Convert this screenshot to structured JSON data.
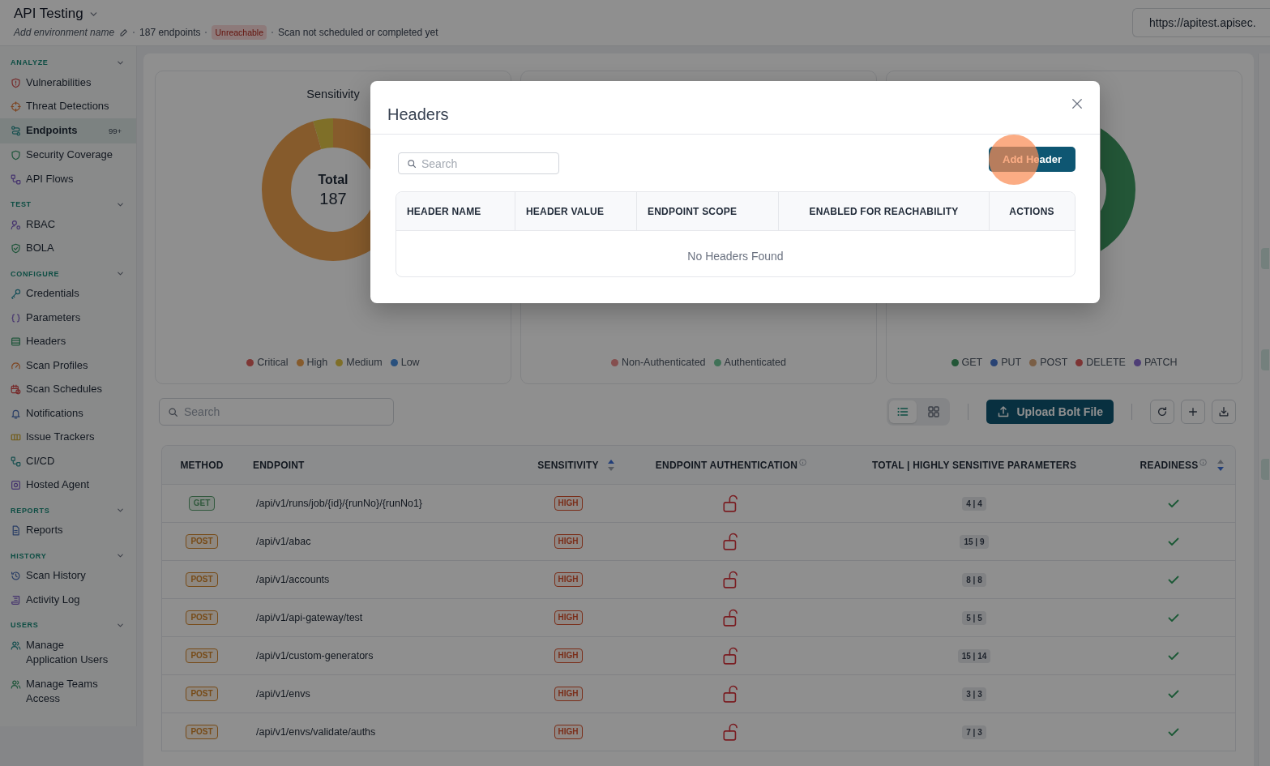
{
  "top_bar": {
    "title": "API Testing",
    "environment_name": "Add environment name",
    "endpoint_count": "187 endpoints",
    "status_badge": "Unreachable",
    "scan_status": "Scan not scheduled or completed yet",
    "url": "https://apitest.apisec."
  },
  "sidebar": {
    "sections": [
      {
        "title": "ANALYZE",
        "expanded": true,
        "items": [
          {
            "label": "Vulnerabilities",
            "selected": false
          },
          {
            "label": "Threat Detections",
            "selected": false
          },
          {
            "label": "Endpoints",
            "selected": true,
            "badge": "99+"
          },
          {
            "label": "Security Coverage",
            "selected": false
          },
          {
            "label": "API Flows",
            "selected": false
          }
        ]
      },
      {
        "title": "TEST",
        "expanded": true,
        "items": [
          {
            "label": "RBAC",
            "selected": false
          },
          {
            "label": "BOLA",
            "selected": false
          }
        ]
      },
      {
        "title": "CONFIGURE",
        "expanded": true,
        "items": [
          {
            "label": "Credentials",
            "selected": false
          },
          {
            "label": "Parameters",
            "selected": false
          },
          {
            "label": "Headers",
            "selected": false
          },
          {
            "label": "Scan Profiles",
            "selected": false
          },
          {
            "label": "Scan Schedules",
            "selected": false
          },
          {
            "label": "Notifications",
            "selected": false
          },
          {
            "label": "Issue Trackers",
            "selected": false
          },
          {
            "label": "CI/CD",
            "selected": false
          },
          {
            "label": "Hosted Agent",
            "selected": false
          }
        ]
      },
      {
        "title": "REPORTS",
        "expanded": true,
        "items": [
          {
            "label": "Reports",
            "selected": false
          }
        ]
      },
      {
        "title": "HISTORY",
        "expanded": true,
        "items": [
          {
            "label": "Scan History",
            "selected": false
          },
          {
            "label": "Activity Log",
            "selected": false
          }
        ]
      },
      {
        "title": "USERS",
        "expanded": true,
        "items": [
          {
            "label": "Manage Application Users",
            "selected": false
          },
          {
            "label": "Manage Teams Access",
            "selected": false
          }
        ]
      }
    ]
  },
  "charts": [
    {
      "title": "Sensitivity",
      "total_label": "Total",
      "total_value": "187",
      "legend": [
        {
          "label": "Critical",
          "color": "#7f3735"
        },
        {
          "label": "High",
          "color": "#865b2c"
        },
        {
          "label": "Medium",
          "color": "#7f6f28"
        },
        {
          "label": "Low",
          "color": "#29507d"
        }
      ]
    },
    {
      "legend": [
        {
          "label": "Non-Authenticated",
          "color": "#854f4f"
        },
        {
          "label": "Authenticated",
          "color": "#407157"
        }
      ]
    },
    {
      "legend": [
        {
          "label": "GET",
          "color": "#235637"
        },
        {
          "label": "PUT",
          "color": "#294374"
        },
        {
          "label": "POST",
          "color": "#7a5e45"
        },
        {
          "label": "DELETE",
          "color": "#7d3434"
        },
        {
          "label": "PATCH",
          "color": "#4e3e76"
        }
      ]
    }
  ],
  "toolbar": {
    "search": {
      "placeholder": "Search"
    },
    "views": [
      {
        "selected": true
      },
      {
        "selected": false
      }
    ],
    "upload_button": "Upload Bolt File"
  },
  "table": {
    "columns": [
      {
        "label": "METHOD",
        "info": false,
        "sortable": false
      },
      {
        "label": "ENDPOINT",
        "info": false,
        "sortable": false
      },
      {
        "label": "SENSITIVITY",
        "info": false,
        "sortable": true,
        "descending": false
      },
      {
        "label": "ENDPOINT AUTHENTICATION",
        "info": true,
        "sortable": false
      },
      {
        "label": "TOTAL | HIGHLY SENSITIVE PARAMETERS",
        "info": false,
        "sortable": false
      },
      {
        "label": "READINESS",
        "info": true,
        "sortable": true,
        "descending": true
      }
    ],
    "rows": [
      {
        "method": {
          "label": "GET",
          "color": "#828984"
        },
        "endpoint": "/api/v1/runs/job/{id}/{runNo}/{runNo1}",
        "sensitivity": "HIGH",
        "authenticated": false,
        "parameters": "4 | 4",
        "ready": true
      },
      {
        "method": {
          "label": "POST",
          "color": "#8e8881"
        },
        "endpoint": "/api/v1/abac",
        "sensitivity": "HIGH",
        "authenticated": false,
        "parameters": "15 | 9",
        "ready": true
      },
      {
        "method": {
          "label": "POST",
          "color": "#8e8881"
        },
        "endpoint": "/api/v1/accounts",
        "sensitivity": "HIGH",
        "authenticated": false,
        "parameters": "8 | 8",
        "ready": true
      },
      {
        "method": {
          "label": "POST",
          "color": "#8e8881"
        },
        "endpoint": "/api/v1/api-gateway/test",
        "sensitivity": "HIGH",
        "authenticated": false,
        "parameters": "5 | 5",
        "ready": true
      },
      {
        "method": {
          "label": "POST",
          "color": "#8e8881"
        },
        "endpoint": "/api/v1/custom-generators",
        "sensitivity": "HIGH",
        "authenticated": false,
        "parameters": "15 | 14",
        "ready": true
      },
      {
        "method": {
          "label": "POST",
          "color": "#8e8881"
        },
        "endpoint": "/api/v1/envs",
        "sensitivity": "HIGH",
        "authenticated": false,
        "parameters": "3 | 3",
        "ready": true
      },
      {
        "method": {
          "label": "POST",
          "color": "#8e8881"
        },
        "endpoint": "/api/v1/envs/validate/auths",
        "sensitivity": "HIGH",
        "authenticated": false,
        "parameters": "7 | 3",
        "ready": true
      }
    ]
  },
  "modal": {
    "title": "Headers",
    "search": {
      "placeholder": "Search"
    },
    "add_button": "Add Header",
    "columns": [
      "HEADER NAME",
      "HEADER VALUE",
      "ENDPOINT SCOPE",
      "ENABLED FOR REACHABILITY",
      "ACTIONS"
    ],
    "empty_message": "No Headers Found"
  }
}
